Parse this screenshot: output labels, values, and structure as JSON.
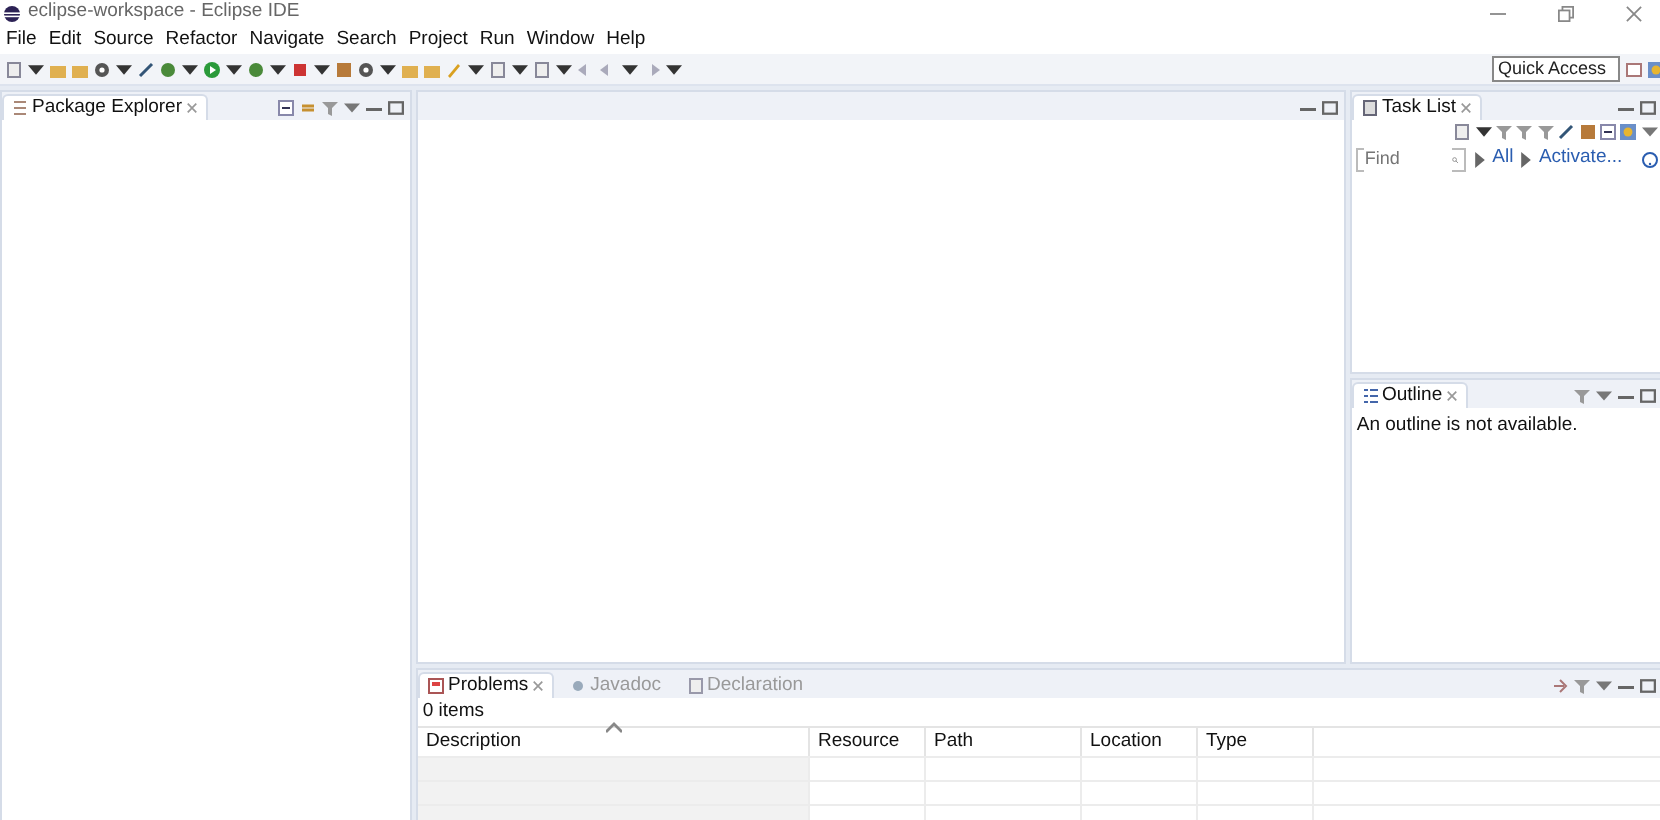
{
  "window": {
    "title": "eclipse-workspace - Eclipse IDE"
  },
  "menu": [
    {
      "label": "File"
    },
    {
      "label": "Edit"
    },
    {
      "label": "Source"
    },
    {
      "label": "Refactor"
    },
    {
      "label": "Navigate"
    },
    {
      "label": "Search"
    },
    {
      "label": "Project"
    },
    {
      "label": "Run"
    },
    {
      "label": "Window"
    },
    {
      "label": "Help"
    }
  ],
  "quick_access": {
    "placeholder": "Quick Access"
  },
  "package_explorer": {
    "tab": "Package Explorer"
  },
  "task_list": {
    "tab": "Task List",
    "find": {
      "placeholder": "Find"
    },
    "links": [
      "All",
      "Activate..."
    ]
  },
  "outline": {
    "tab": "Outline",
    "message": "An outline is not available."
  },
  "bottom_panel": {
    "tabs": [
      {
        "label": "Problems",
        "selected": true
      },
      {
        "label": "Javadoc",
        "selected": false
      },
      {
        "label": "Declaration",
        "selected": false
      }
    ],
    "summary": "0 items",
    "table": {
      "columns": [
        {
          "label": "Description",
          "sorted": true
        },
        {
          "label": "Resource",
          "sorted": false
        },
        {
          "label": "Path",
          "sorted": false
        },
        {
          "label": "Location",
          "sorted": false
        },
        {
          "label": "Type",
          "sorted": false
        }
      ]
    }
  }
}
